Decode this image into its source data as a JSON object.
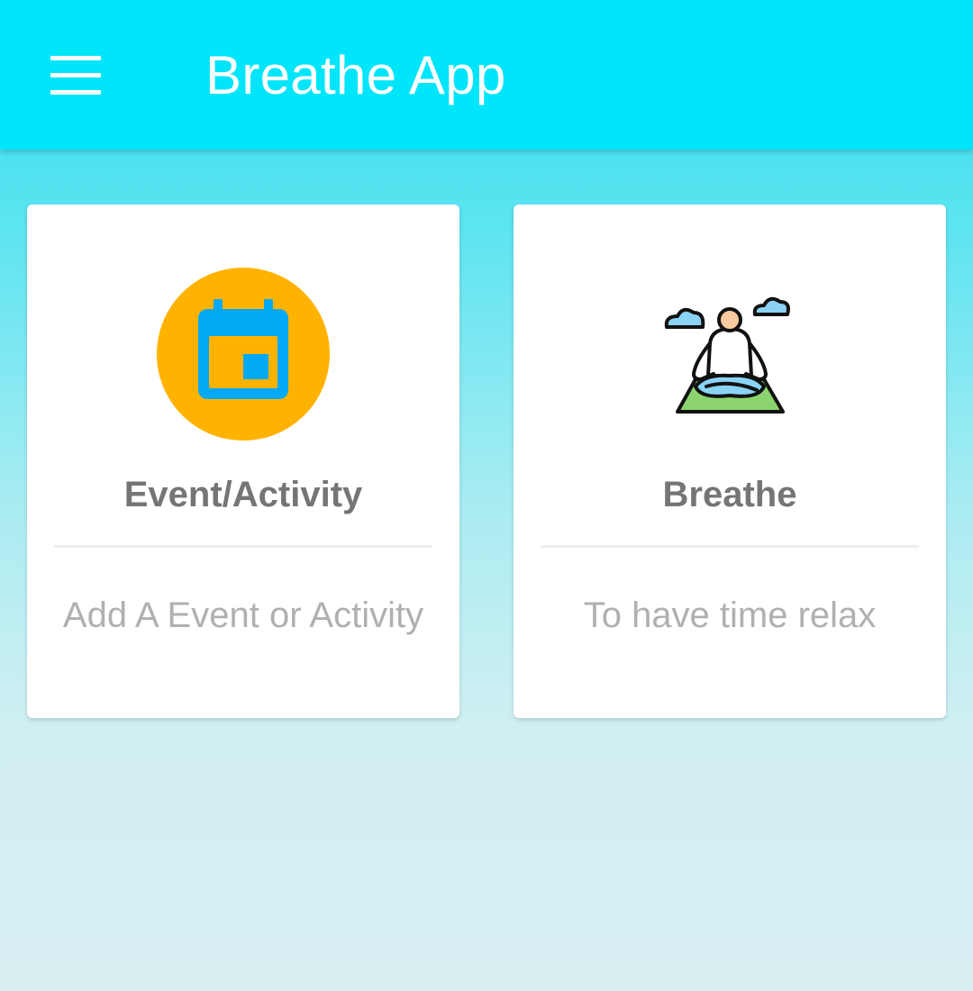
{
  "app_bar": {
    "title": "Breathe App",
    "menu_icon": "hamburger-menu-icon",
    "background_color": "#00e5f9"
  },
  "cards": [
    {
      "title": "Event/Activity",
      "subtitle": "Add A Event or Activity",
      "icon": "calendar-icon",
      "icon_background": "#ffb300",
      "icon_color": "#03a9f4"
    },
    {
      "title": "Breathe",
      "subtitle": "To have time relax",
      "icon": "meditation-icon"
    }
  ]
}
